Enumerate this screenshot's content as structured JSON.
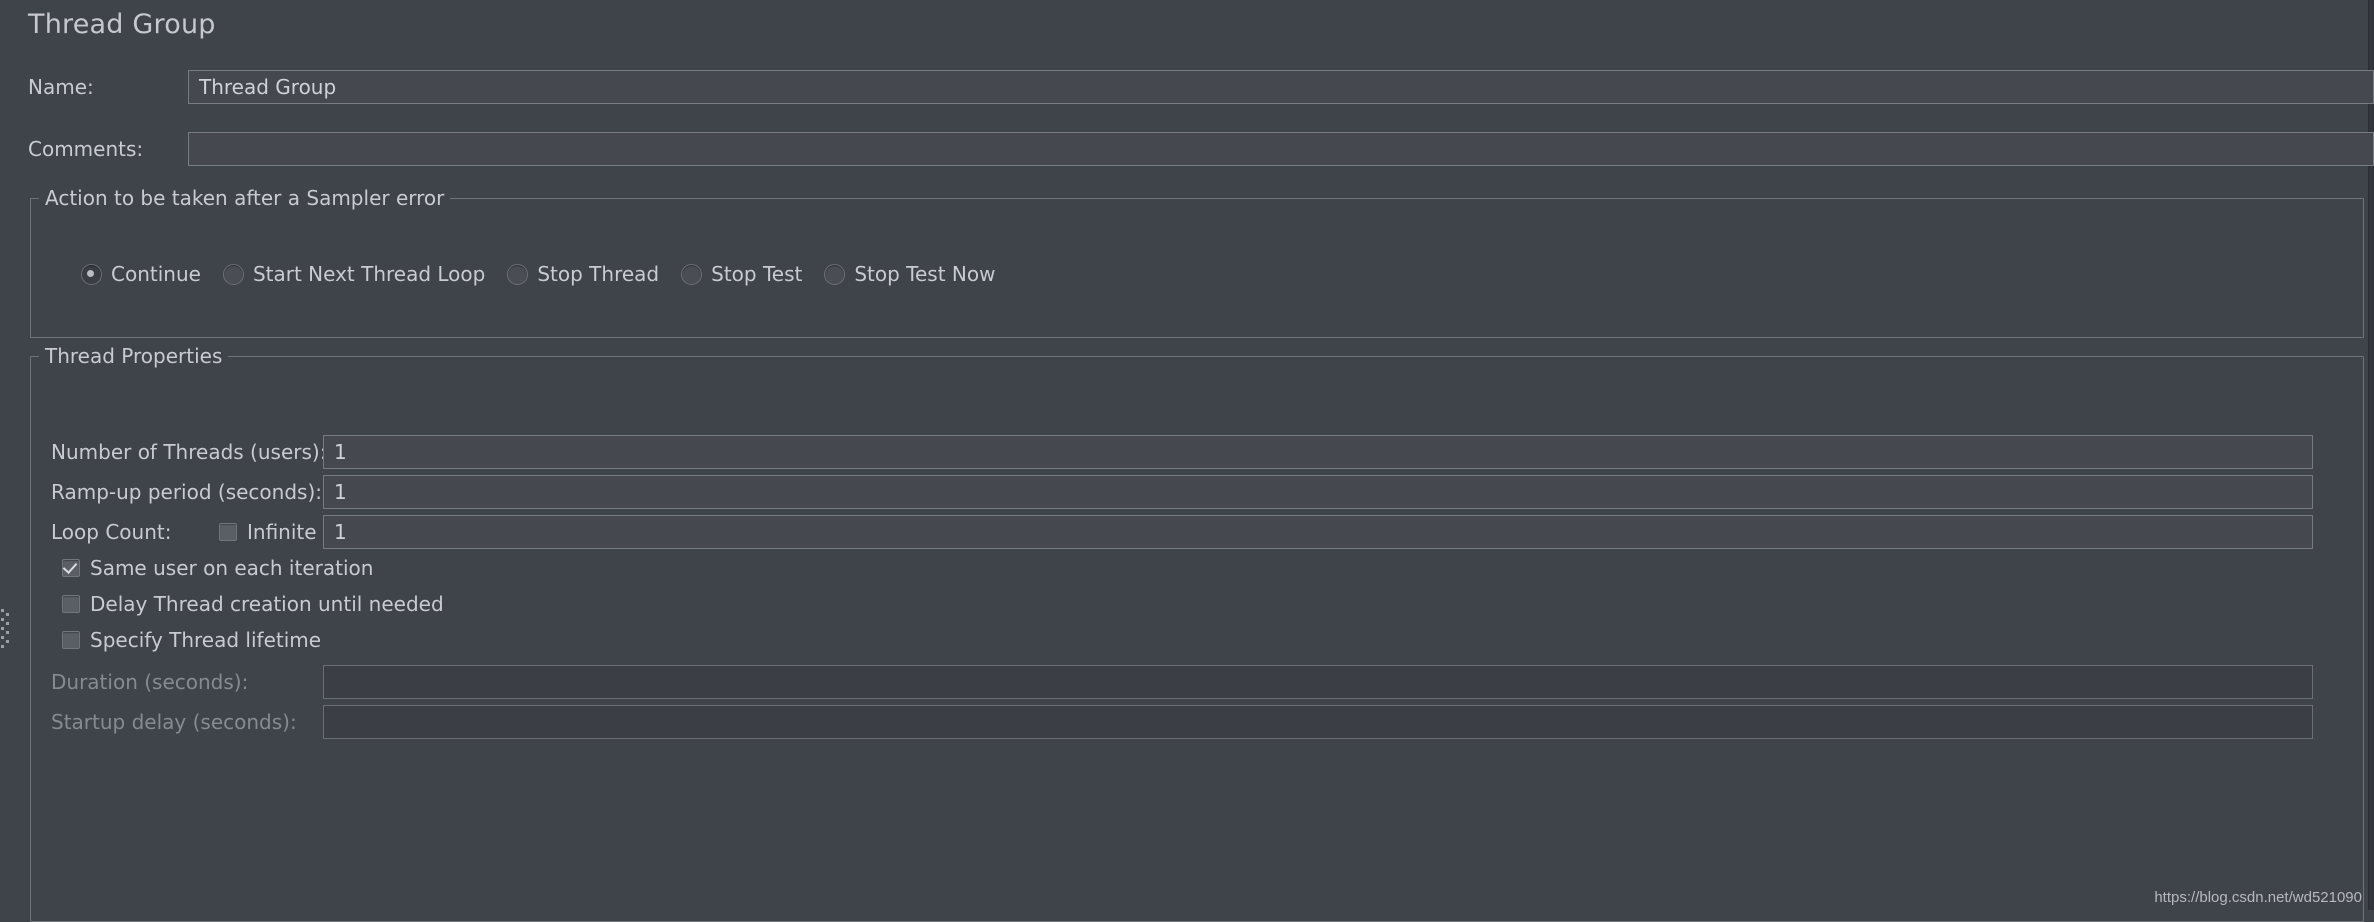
{
  "window": {
    "title": "Thread Group",
    "background_color": "#3f434a",
    "text_color": "#c8cbcf",
    "field_background": "#45494f",
    "field_border": "#777c82",
    "disabled_text_color": "#868b92"
  },
  "form": {
    "name_label": "Name:",
    "name_value": "Thread Group",
    "name_placeholder": "",
    "comments_label": "Comments:",
    "comments_value": "",
    "comments_placeholder": ""
  },
  "sampler_error_group": {
    "legend": "Action to be taken after a Sampler error",
    "selected": "Continue",
    "options": [
      {
        "label": "Continue",
        "checked": true
      },
      {
        "label": "Start Next Thread Loop",
        "checked": false
      },
      {
        "label": "Stop Thread",
        "checked": false
      },
      {
        "label": "Stop Test",
        "checked": false
      },
      {
        "label": "Stop Test Now",
        "checked": false
      }
    ]
  },
  "thread_properties": {
    "legend": "Thread Properties",
    "num_threads_label": "Number of Threads (users):",
    "num_threads_value": "1",
    "rampup_label": "Ramp-up period (seconds):",
    "rampup_value": "1",
    "loop_count_label": "Loop Count:",
    "loop_infinite_label": "Infinite",
    "loop_infinite_checked": false,
    "loop_count_value": "1",
    "same_user_label": "Same user on each iteration",
    "same_user_checked": true,
    "delay_thread_label": "Delay Thread creation until needed",
    "delay_thread_checked": false,
    "specify_lifetime_label": "Specify Thread lifetime",
    "specify_lifetime_checked": false,
    "duration_label": "Duration (seconds):",
    "duration_value": "",
    "duration_enabled": false,
    "startup_delay_label": "Startup delay (seconds):",
    "startup_delay_value": "",
    "startup_delay_enabled": false
  },
  "watermark": {
    "text": "https://blog.csdn.net/wd521090"
  }
}
